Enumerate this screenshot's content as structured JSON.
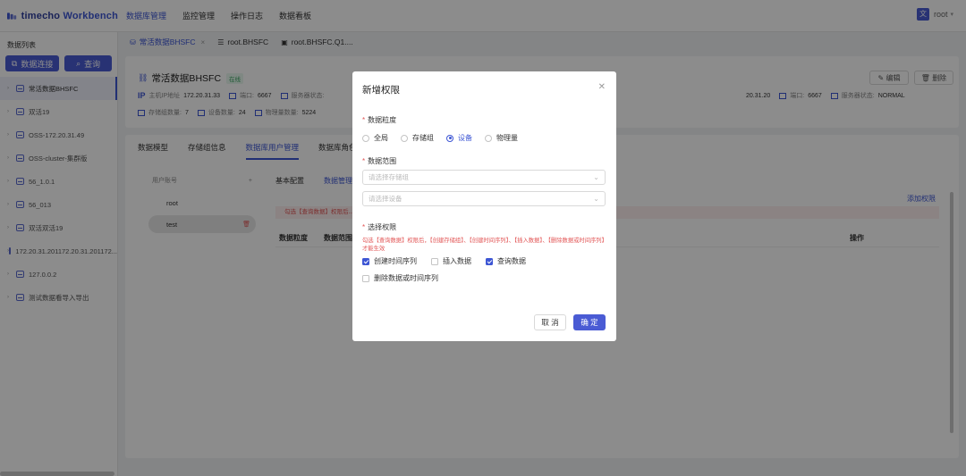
{
  "app": {
    "brand_prefix": "timecho",
    "brand_suffix": "Workbench"
  },
  "topnav": [
    "数据库管理",
    "监控管理",
    "操作日志",
    "数据看板"
  ],
  "user": {
    "name": "root"
  },
  "sidebar": {
    "title": "数据列表",
    "connect_btn": "数据连接",
    "query_btn": "查询",
    "items": [
      "常活数据BHSFC",
      "双活19",
      "OSS-172.20.31.49",
      "OSS-cluster-集群版",
      "56_1.0.1",
      "56_013",
      "双活双活19",
      "172.20.31.201172.20.31.201172...",
      "127.0.0.2",
      "测试数据看导入导出"
    ]
  },
  "tabs": [
    {
      "label": "常活数据BHSFC"
    },
    {
      "label": "root.BHSFC"
    },
    {
      "label": "root.BHSFC.Q1...."
    }
  ],
  "info": {
    "title": "常活数据BHSFC",
    "status": "在线",
    "ip_badge": "IP",
    "ip_key": "主机IP地址",
    "ip_val": "172.20.31.33",
    "port_key": "端口:",
    "port_val": "6667",
    "svc_key": "服务器状态:",
    "ip2_val": "20.31.20",
    "port2_key": "端口:",
    "port2_val": "6667",
    "svc2_key": "服务器状态:",
    "svc2_val": "NORMAL",
    "storage_key": "存储组数量:",
    "storage_val": "7",
    "device_key": "设备数量:",
    "device_val": "24",
    "physical_key": "物理量数量:",
    "physical_val": "5224",
    "edit_btn": "编辑",
    "delete_btn": "删除"
  },
  "detail_tabs": [
    "数据模型",
    "存储组信息",
    "数据库用户管理",
    "数据库角色管"
  ],
  "users": {
    "header": "用户账号",
    "add": "+",
    "rows": [
      "root",
      "test"
    ]
  },
  "subtabs": [
    "基本配置",
    "数据管理"
  ],
  "add_perm": "添加权限",
  "warn_strip": "勾选【查询数据】权限后...",
  "table_headers": [
    "数据粒度",
    "数据范围"
  ],
  "table_ops": "操作",
  "modal": {
    "title": "新增权限",
    "granularity_label": "数据粒度",
    "granularity_options": [
      "全局",
      "存储组",
      "设备",
      "物理量"
    ],
    "granularity_selected": "设备",
    "scope_label": "数据范围",
    "storage_placeholder": "请选择存储组",
    "device_placeholder": "请选择设备",
    "perm_label": "选择权限",
    "perm_note": "勾选【查询数据】权限后，【创建存储组】、【创建时间序列】、【插入数据】、【删除数据或时间序列】才能生效",
    "perms": [
      {
        "label": "创建时间序列",
        "checked": true
      },
      {
        "label": "插入数据",
        "checked": false
      },
      {
        "label": "查询数据",
        "checked": true
      },
      {
        "label": "删除数据或时间序列",
        "checked": false
      }
    ],
    "cancel": "取 消",
    "ok": "确 定"
  }
}
